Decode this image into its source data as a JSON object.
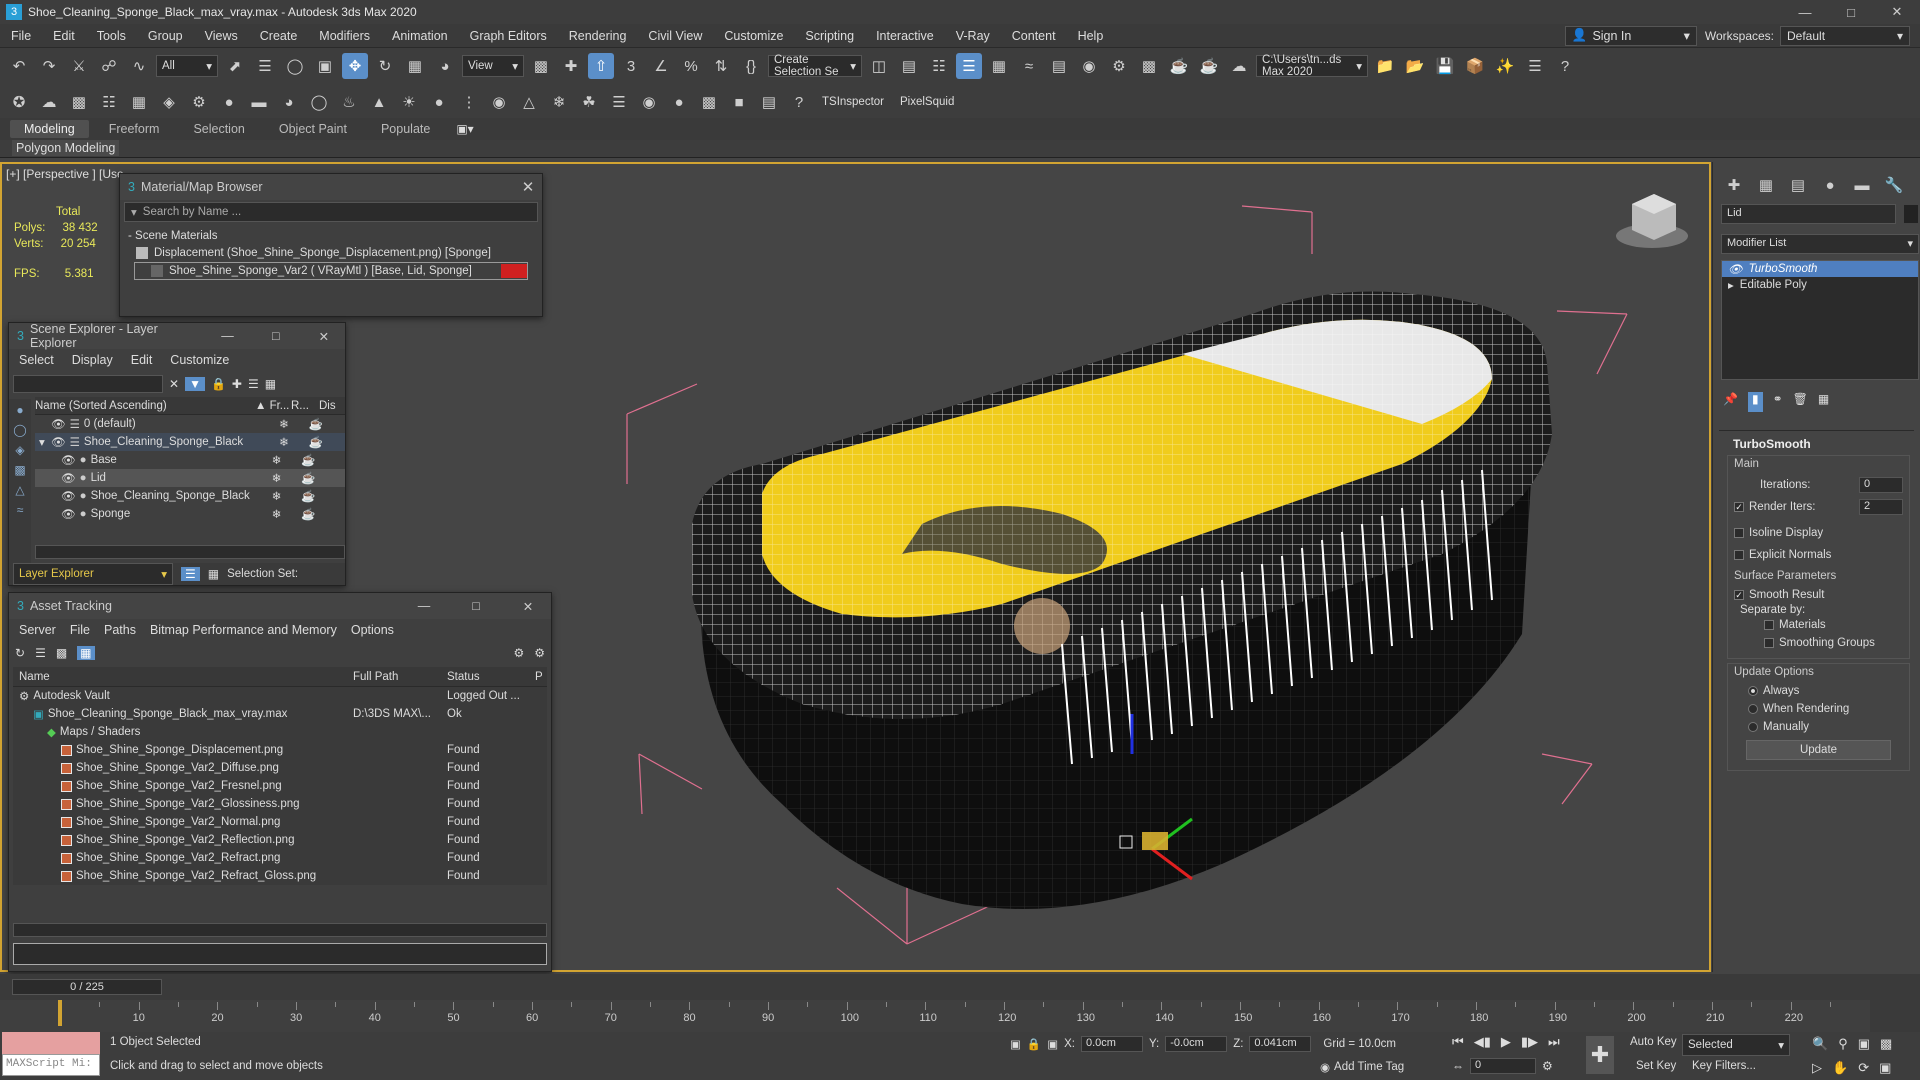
{
  "window": {
    "title": "Shoe_Cleaning_Sponge_Black_max_vray.max - Autodesk 3ds Max 2020"
  },
  "menu": [
    "File",
    "Edit",
    "Tools",
    "Group",
    "Views",
    "Create",
    "Modifiers",
    "Animation",
    "Graph Editors",
    "Rendering",
    "Civil View",
    "Customize",
    "Scripting",
    "Interactive",
    "V-Ray",
    "Content",
    "Help"
  ],
  "signin": "Sign In",
  "workspaces": {
    "label": "Workspaces:",
    "value": "Default"
  },
  "toolbar1": {
    "filter": "All",
    "view": "View",
    "selection_set": "Create Selection Se",
    "path": "C:\\Users\\tn...ds Max 2020"
  },
  "toolbar2": {
    "tsinspector": "TSInspector",
    "pixelsquid": "PixelSquid"
  },
  "ribbon": {
    "tabs": [
      "Modeling",
      "Freeform",
      "Selection",
      "Object Paint",
      "Populate"
    ],
    "sub": "Polygon Modeling"
  },
  "viewport": {
    "label": "[+] [Perspective ] [Use",
    "stats": {
      "header": "Total",
      "polys_label": "Polys:",
      "polys": "38 432",
      "verts_label": "Verts:",
      "verts": "20 254",
      "fps_label": "FPS:",
      "fps": "5.381"
    }
  },
  "material_browser": {
    "title": "Material/Map Browser",
    "search": "Search by Name ...",
    "section": "Scene Materials",
    "items": [
      "Displacement (Shoe_Shine_Sponge_Displacement.png) [Sponge]",
      "Shoe_Shine_Sponge_Var2  ( VRayMtl )  [Base, Lid, Sponge]"
    ]
  },
  "scene_explorer": {
    "title": "Scene Explorer - Layer Explorer",
    "menu": [
      "Select",
      "Display",
      "Edit",
      "Customize"
    ],
    "col_name": "Name (Sorted Ascending)",
    "col_fr": "▲ Fr...",
    "col_r": "R...",
    "col_dis": "Dis",
    "rows": [
      {
        "name": "0 (default)",
        "indent": 1,
        "selected": false
      },
      {
        "name": "Shoe_Cleaning_Sponge_Black",
        "indent": 1,
        "selected": true
      },
      {
        "name": "Base",
        "indent": 2,
        "selected": false
      },
      {
        "name": "Lid",
        "indent": 2,
        "selected": false,
        "highlight": true
      },
      {
        "name": "Shoe_Cleaning_Sponge_Black",
        "indent": 2,
        "selected": false
      },
      {
        "name": "Sponge",
        "indent": 2,
        "selected": false
      }
    ],
    "footer_explorer": "Layer Explorer",
    "footer_selection": "Selection Set:"
  },
  "asset_tracking": {
    "title": "Asset Tracking",
    "menu": [
      "Server",
      "File",
      "Paths",
      "Bitmap Performance and Memory",
      "Options"
    ],
    "columns": [
      "Name",
      "Full Path",
      "Status",
      "P"
    ],
    "rows": [
      {
        "name": "Autodesk Vault",
        "path": "",
        "status": "Logged Out ...",
        "indent": 1
      },
      {
        "name": "Shoe_Cleaning_Sponge_Black_max_vray.max",
        "path": "D:\\3DS MAX\\...",
        "status": "Ok",
        "indent": 2
      },
      {
        "name": "Maps / Shaders",
        "path": "",
        "status": "",
        "indent": 3
      },
      {
        "name": "Shoe_Shine_Sponge_Displacement.png",
        "path": "",
        "status": "Found",
        "indent": 4
      },
      {
        "name": "Shoe_Shine_Sponge_Var2_Diffuse.png",
        "path": "",
        "status": "Found",
        "indent": 4
      },
      {
        "name": "Shoe_Shine_Sponge_Var2_Fresnel.png",
        "path": "",
        "status": "Found",
        "indent": 4
      },
      {
        "name": "Shoe_Shine_Sponge_Var2_Glossiness.png",
        "path": "",
        "status": "Found",
        "indent": 4
      },
      {
        "name": "Shoe_Shine_Sponge_Var2_Normal.png",
        "path": "",
        "status": "Found",
        "indent": 4
      },
      {
        "name": "Shoe_Shine_Sponge_Var2_Reflection.png",
        "path": "",
        "status": "Found",
        "indent": 4
      },
      {
        "name": "Shoe_Shine_Sponge_Var2_Refract.png",
        "path": "",
        "status": "Found",
        "indent": 4
      },
      {
        "name": "Shoe_Shine_Sponge_Var2_Refract_Gloss.png",
        "path": "",
        "status": "Found",
        "indent": 4
      }
    ]
  },
  "command_panel": {
    "object_name": "Lid",
    "modifier_list": "Modifier List",
    "stack": [
      "TurboSmooth",
      "Editable Poly"
    ],
    "turbosmooth": {
      "title": "TurboSmooth",
      "main": "Main",
      "iterations_label": "Iterations:",
      "iterations": "0",
      "render_iters_label": "Render Iters:",
      "render_iters": "2",
      "isoline": "Isoline Display",
      "explicit": "Explicit Normals",
      "surface": "Surface Parameters",
      "smooth_result": "Smooth Result",
      "separate_by": "Separate by:",
      "materials": "Materials",
      "smoothing_groups": "Smoothing Groups",
      "update_options": "Update Options",
      "always": "Always",
      "when_rendering": "When Rendering",
      "manually": "Manually",
      "update": "Update"
    }
  },
  "timeline": {
    "frame": "0 / 225",
    "ticks": [
      "10",
      "20",
      "30",
      "40",
      "50",
      "60",
      "70",
      "80",
      "90",
      "100",
      "110",
      "120",
      "130",
      "140",
      "150",
      "160",
      "170",
      "180",
      "190",
      "200",
      "210",
      "220"
    ]
  },
  "status": {
    "maxscript": "MAXScript Mi:",
    "selected": "1 Object Selected",
    "prompt": "Click and drag to select and move objects",
    "x_label": "X:",
    "x": "0.0cm",
    "y_label": "Y:",
    "y": "-0.0cm",
    "z_label": "Z:",
    "z": "0.041cm",
    "grid": "Grid = 10.0cm",
    "add_time_tag": "Add Time Tag",
    "auto_key": "Auto Key",
    "selected_combo": "Selected",
    "set_key": "Set Key",
    "key_filters": "Key Filters...",
    "frame_field": "0"
  }
}
